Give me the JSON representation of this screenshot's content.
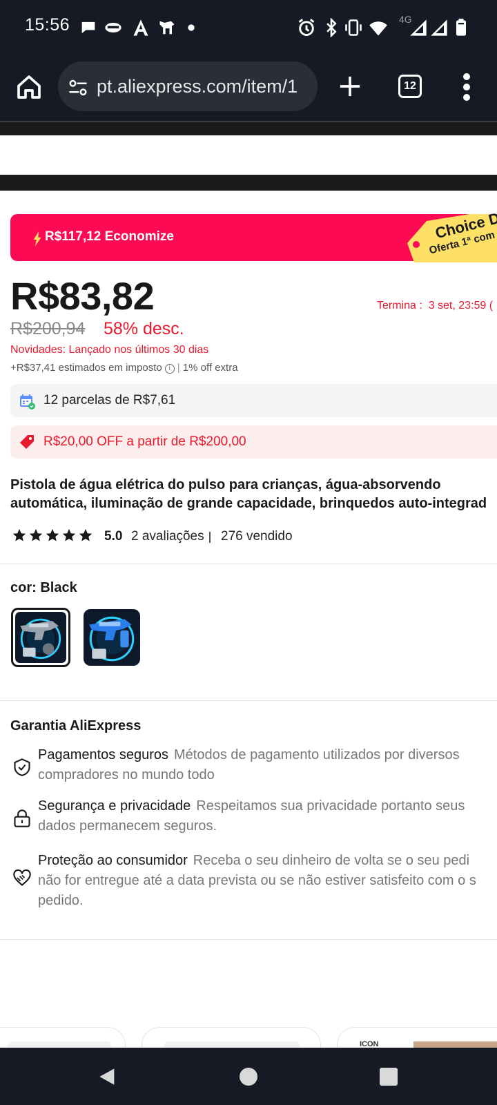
{
  "status_bar": {
    "time": "15:56",
    "network_label": "4G",
    "icons": [
      "chat-bubble-icon",
      "visor-icon",
      "a-icon",
      "pony-icon",
      "dot-icon",
      "alarm-icon",
      "bluetooth-icon",
      "vibrate-icon",
      "wifi-icon",
      "signal-icon",
      "signal-icon",
      "battery-icon"
    ]
  },
  "browser": {
    "url": "pt.aliexpress.com/item/1",
    "tab_count": "12",
    "icons": [
      "home-icon",
      "site-settings-icon",
      "plus-icon",
      "tabs-icon",
      "more-vert-icon"
    ]
  },
  "promo": {
    "savings": "R$117,12 Economize",
    "choice_word": "Choice Do",
    "choice_sub": "Oferta 1ª com"
  },
  "price": {
    "current": "R$83,82",
    "ends_label": "Termina :",
    "ends_value": "3 set, 23:59 (",
    "original": "R$200,94",
    "discount": "58% desc.",
    "novelty": "Novidades: Lançado nos últimos 30 dias",
    "tax": "+R$37,41 estimados em imposto",
    "extra": "1% off extra"
  },
  "installments": {
    "text": "12 parcelas de R$7,61"
  },
  "coupon": {
    "text": "R$20,00 OFF a partir de R$200,00"
  },
  "product": {
    "title_line1": "Pistola de água elétrica do pulso para crianças, água-absorvendo",
    "title_line2": "automática, iluminação de grande capacidade, brinquedos auto-integrad",
    "rating": "5.0",
    "reviews": "2 avaliações",
    "sold": "276 vendido",
    "stars": 5
  },
  "color": {
    "label": "cor: Black",
    "selected": "Black"
  },
  "guarantee": {
    "title": "Garantia AliExpress",
    "items": [
      {
        "title": "Pagamentos seguros",
        "line1": "Métodos de pagamento utilizados por diversos",
        "line2": "compradores no mundo todo",
        "line3": "",
        "icon": "shield-check-icon"
      },
      {
        "title": "Segurança e privacidade",
        "line1": "Respeitamos sua privacidade portanto seus",
        "line2": "dados permanecem seguros.",
        "line3": "",
        "icon": "lock-icon"
      },
      {
        "title": "Proteção ao consumidor",
        "line1": "Receba o seu dinheiro de volta se o seu pedi",
        "line2": "não for entregue até a data prevista ou se não estiver satisfeito com o s",
        "line3": "pedido.",
        "icon": "handshake-heart-icon"
      }
    ]
  },
  "recommendations": {
    "peek_text": "ICON"
  },
  "colors": {
    "accent_red": "#fd0a54",
    "price_red": "#e8192c",
    "choice_yellow": "#ffe066",
    "dark_chrome": "#161a24"
  }
}
